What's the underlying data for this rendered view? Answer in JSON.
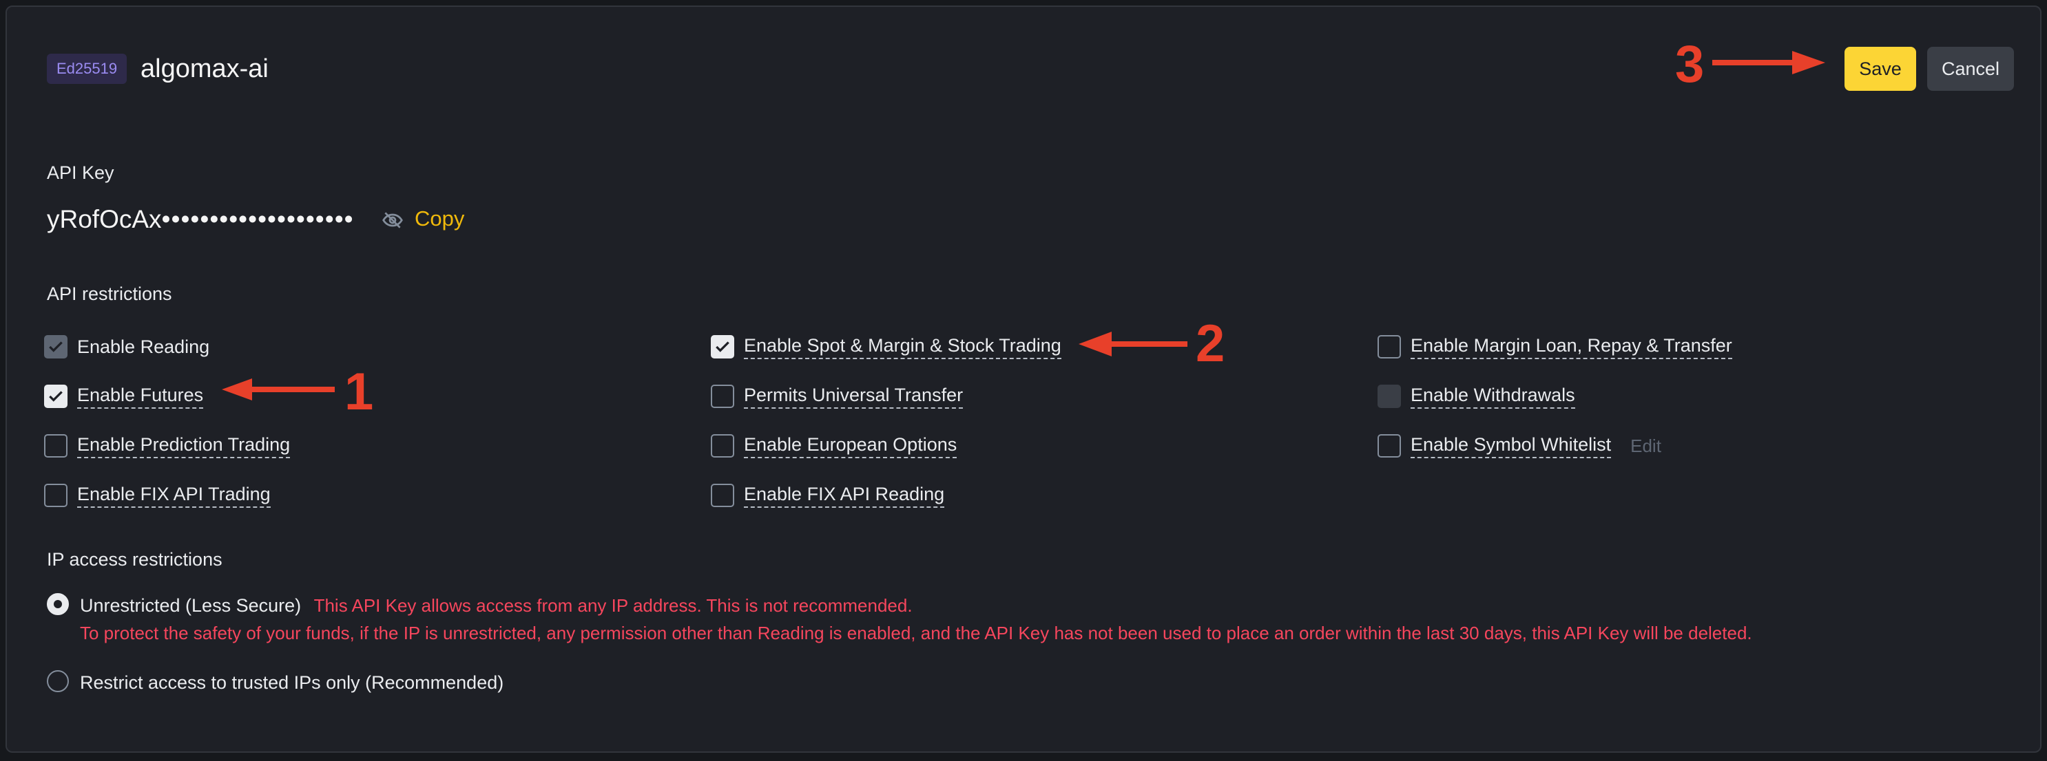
{
  "header": {
    "key_type_badge": "Ed25519",
    "key_name": "algomax-ai",
    "save_label": "Save",
    "cancel_label": "Cancel"
  },
  "api_key": {
    "label": "API Key",
    "visible_part": "yRofOcAx",
    "masked_part": "••••••••••••••••••••",
    "copy_label": "Copy"
  },
  "restrictions": {
    "label": "API restrictions",
    "permissions": [
      {
        "label": "Enable Reading",
        "state": "checked-disabled"
      },
      {
        "label": "Enable Futures",
        "state": "checked"
      },
      {
        "label": "Enable Prediction Trading",
        "state": "unchecked"
      },
      {
        "label": "Enable FIX API Trading",
        "state": "unchecked"
      },
      {
        "label": "Enable Spot & Margin & Stock Trading",
        "state": "checked"
      },
      {
        "label": "Permits Universal Transfer",
        "state": "unchecked"
      },
      {
        "label": "Enable European Options",
        "state": "unchecked"
      },
      {
        "label": "Enable FIX API Reading",
        "state": "unchecked"
      },
      {
        "label": "Enable Margin Loan, Repay & Transfer",
        "state": "unchecked"
      },
      {
        "label": "Enable Withdrawals",
        "state": "disabled"
      },
      {
        "label": "Enable Symbol Whitelist",
        "state": "unchecked",
        "edit_label": "Edit"
      }
    ]
  },
  "ip_access": {
    "label": "IP access restrictions",
    "options": [
      {
        "label": "Unrestricted (Less Secure)",
        "selected": true,
        "warning_line1": "This API Key allows access from any IP address. This is not recommended.",
        "warning_line2": "To protect the safety of your funds, if the IP is unrestricted, any permission other than Reading is enabled, and the API Key has not been used to place an order within the last 30 days, this API Key will be deleted."
      },
      {
        "label": "Restrict access to trusted IPs only (Recommended)",
        "selected": false
      }
    ]
  },
  "annotations": {
    "one": "1",
    "two": "2",
    "three": "3"
  },
  "colors": {
    "accent": "#fcd535",
    "annotation": "#e8402a",
    "warning": "#f6465d"
  }
}
